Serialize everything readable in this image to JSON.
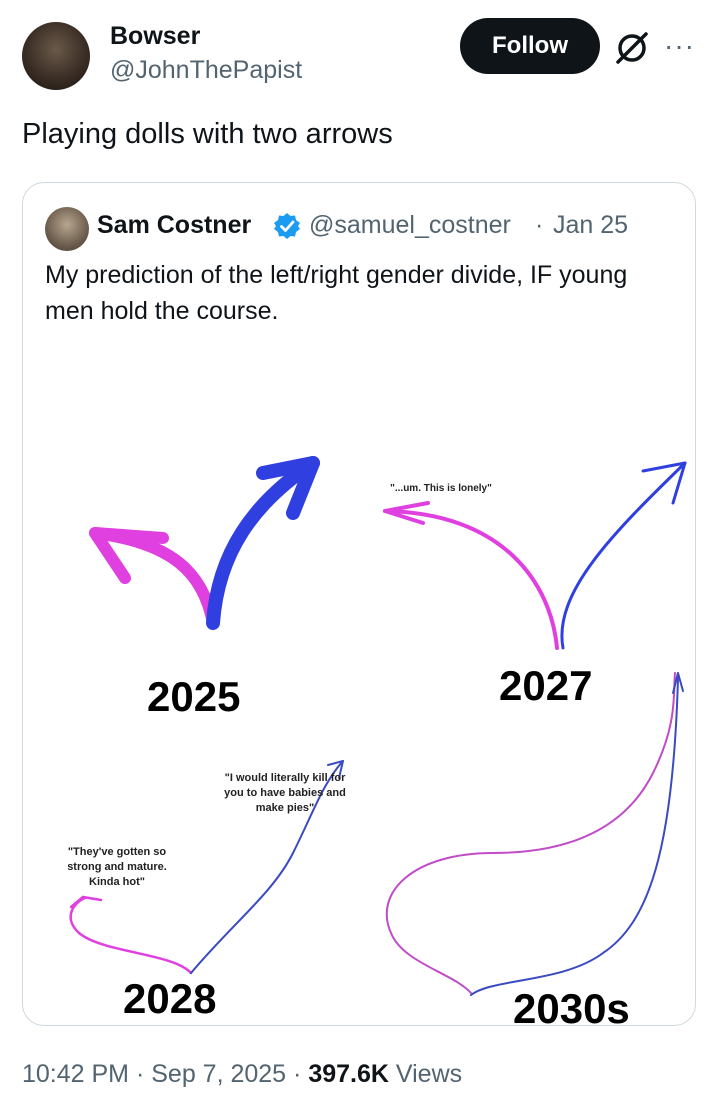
{
  "author": {
    "display_name": "Bowser",
    "handle": "@JohnThePapist"
  },
  "follow_label": "Follow",
  "more_label": "···",
  "tweet_text": "Playing dolls with two arrows",
  "quote": {
    "display_name": "Sam Costner",
    "handle": "@samuel_costner",
    "separator": "·",
    "date": "Jan 25",
    "text": "My prediction of the left/right gender divide, IF young men hold the course.",
    "panels": [
      {
        "year": "2025"
      },
      {
        "year": "2027",
        "note": "\"...um. This is lonely\""
      },
      {
        "year": "2028",
        "note_left": [
          "\"They've gotten so",
          "strong and mature.",
          "Kinda hot\""
        ],
        "note_right": [
          "\"I would literally kill for",
          "you to have babies and",
          "make pies\""
        ]
      },
      {
        "year": "2030s"
      }
    ]
  },
  "footer": {
    "time": "10:42 PM",
    "sep1": "·",
    "date": "Sep 7, 2025",
    "sep2": "·",
    "views_count": "397.6K",
    "views_label": "Views"
  },
  "colors": {
    "pink": "#e040e0",
    "blue": "#2f3fe0",
    "text": "#0f1419",
    "muted": "#536471",
    "verified": "#1d9bf0"
  }
}
